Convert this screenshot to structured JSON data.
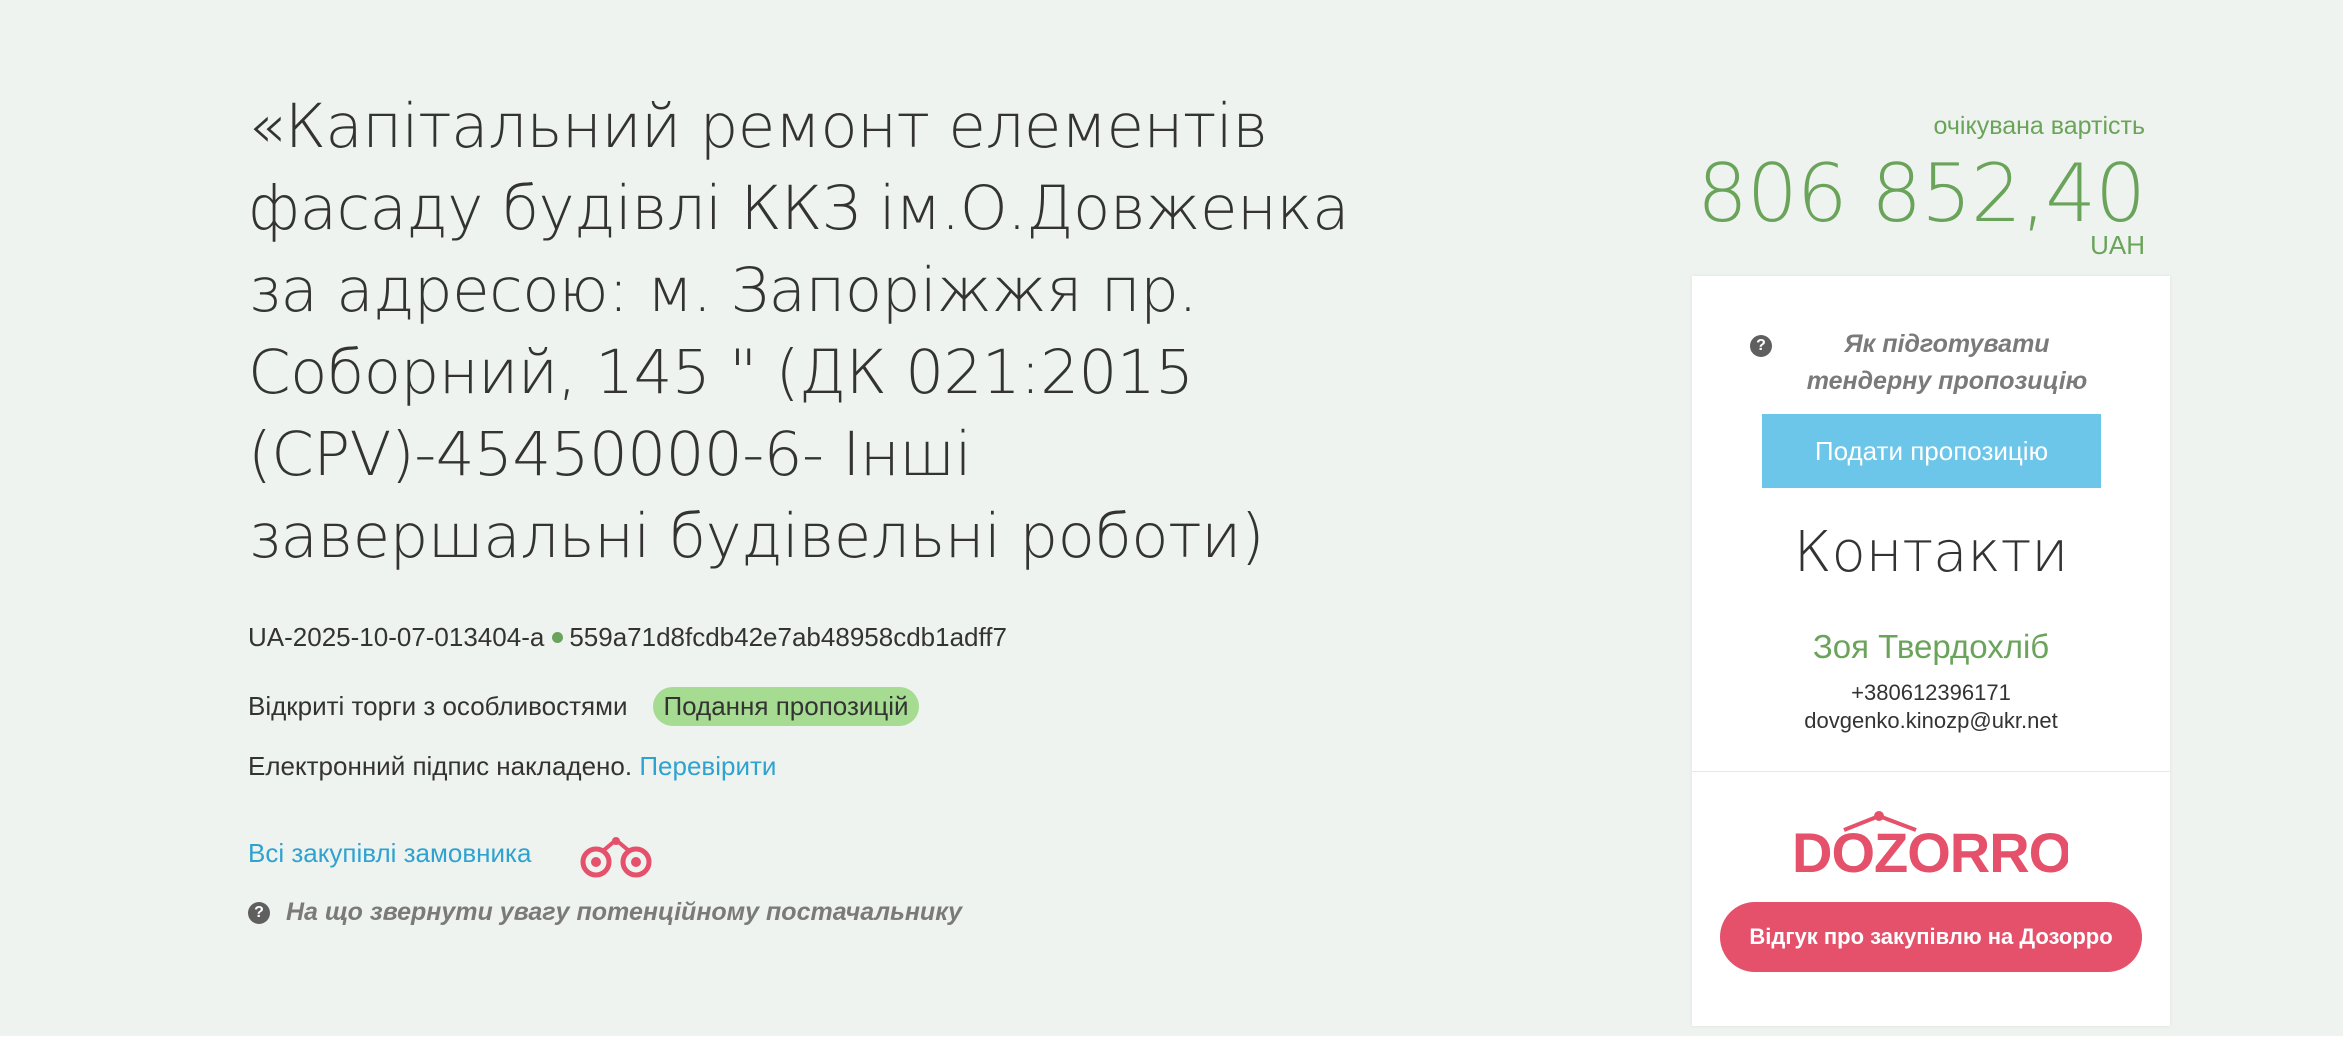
{
  "tender": {
    "title": "«Капітальний ремонт елементів фасаду будівлі ККЗ ім.О.Довженка за адресою: м. Запоріжжя пр. Соборний, 145 \" (ДК 021:2015 (CPV)-45450000-6- Інші завершальні будівельні роботи)",
    "tender_id": "UA-2025-10-07-013404-a",
    "hash": "559a71d8fcdb42e7ab48958cdb1adff7",
    "procedure_type": "Відкриті торги з особливостями",
    "status": "Подання пропозицій",
    "signature_text": "Електронний підпис накладено.",
    "verify_link": "Перевірити",
    "all_purchases_link": "Всі закупівлі замовника",
    "attention_text": "На що звернути увагу потенційному постачальнику"
  },
  "price": {
    "label": "очікувана вартість",
    "value": "806 852,40",
    "currency": "UAH"
  },
  "sidebar": {
    "howto_text": "Як підготувати тендерну пропозицію",
    "submit_button": "Подати пропозицію",
    "contacts_title": "Контакти",
    "contact_name": "Зоя Твердохліб",
    "contact_phone": "+380612396171",
    "contact_email": "dovgenko.kinozp@ukr.net",
    "logo_text": "DOZORRO",
    "dozorro_button": "Відгук про закупівлю на Дозорро"
  },
  "colors": {
    "background": "#eff3ef",
    "accent_green": "#6aa35a",
    "link_blue": "#2ea2d0",
    "submit_blue": "#6cc6e9",
    "badge_green": "#a6db92",
    "dozorro_red": "#e5506a"
  },
  "icons": [
    "question-circle-icon",
    "binoculars-icon"
  ]
}
